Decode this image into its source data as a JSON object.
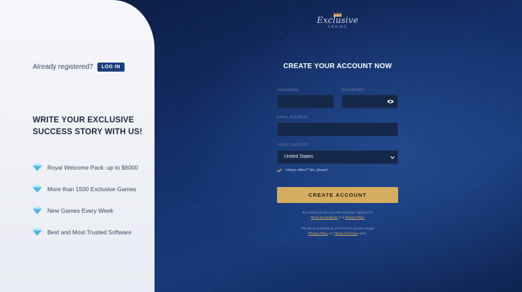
{
  "left": {
    "already_text": "Already registered?",
    "login_label": "LOG IN",
    "headline_line1": "WRITE YOUR EXCLUSIVE",
    "headline_line2": "SUCCESS STORY WITH US!",
    "features": [
      {
        "label": "Royal Welcome Pack: up to $6000",
        "icon": "diamond-icon"
      },
      {
        "label": "More than 1500 Exclusive Games",
        "icon": "diamond-icon"
      },
      {
        "label": "New Games Every Week",
        "icon": "diamond-icon"
      },
      {
        "label": "Best and Most Trusted Software",
        "icon": "diamond-icon"
      }
    ]
  },
  "logo": {
    "script": "Exclusive",
    "sub": "CASINO"
  },
  "form": {
    "title": "CREATE YOUR ACCOUNT NOW",
    "username_label": "USERNAME",
    "username_value": "",
    "password_label": "PASSWORD",
    "password_value": "",
    "email_label": "EMAIL ADDRESS",
    "email_value": "",
    "country_label": "YOUR COUNTRY",
    "country_value": "United States",
    "offers_label": "Unique offers? Yes, please!",
    "offers_checked": true,
    "submit_label": "CREATE ACCOUNT"
  },
  "legal": {
    "agree_prefix": "By creating an account with Exclusive I agree to its",
    "terms_link": "Terms & Conditions",
    "and1": "and",
    "privacy_link": "Privacy Policy",
    "recaptcha_prefix": "This site is protected by reCAPTCHA and the Google",
    "privacy_link2": "Privacy Policy",
    "and2": "and",
    "tos_link": "Terms of Service",
    "apply": "apply."
  },
  "colors": {
    "accent_gold": "#d4ad60",
    "login_blue": "#1c3f7c",
    "panel_bg": "#f6f7fa",
    "field_bg": "#162849"
  }
}
